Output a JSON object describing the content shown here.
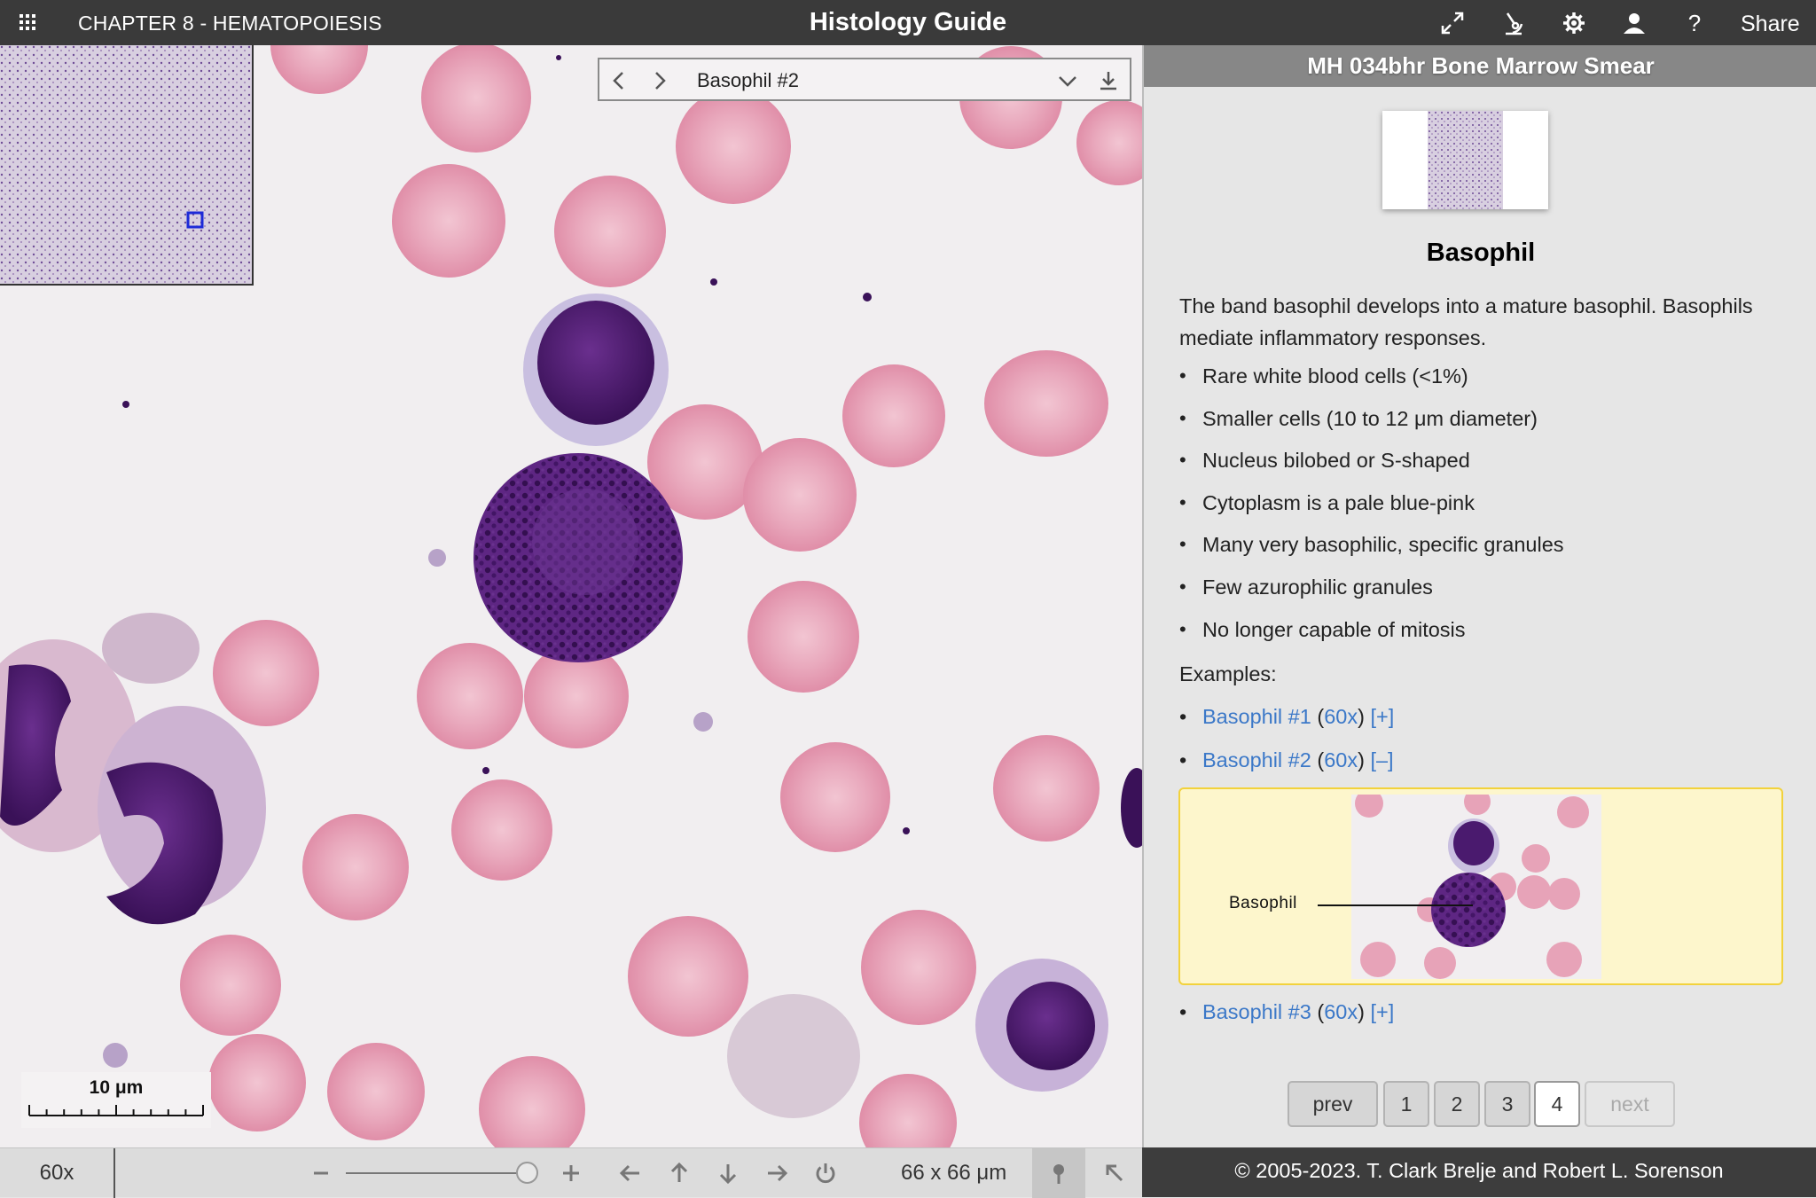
{
  "topbar": {
    "chapter": "CHAPTER 8 - HEMATOPOIESIS",
    "brand": "Histology Guide",
    "share": "Share",
    "icons": [
      "apps-grid-icon",
      "fullscreen-icon",
      "microscope-icon",
      "gear-icon",
      "user-icon",
      "help-icon"
    ]
  },
  "viewer": {
    "nav_label": "Basophil #2",
    "scale_label": "10 μm",
    "magnification": "60x",
    "dimensions": "66 x 66 μm",
    "zoom_level": 1.0
  },
  "panel": {
    "header": "MH 034bhr Bone Marrow Smear",
    "title": "Basophil",
    "description": "The band basophil develops into a mature basophil. Basophils mediate inflammatory responses.",
    "bullets": [
      "Rare white blood cells (<1%)",
      "Smaller cells (10 to 12 μm diameter)",
      "Nucleus bilobed or S-shaped",
      "Cytoplasm is a pale blue-pink",
      "Many very basophilic, specific granules",
      "Few azurophilic granules",
      "No longer capable of mitosis"
    ],
    "examples_label": "Examples:",
    "examples": [
      {
        "name": "Basophil #1",
        "mag": "60x",
        "toggle": "[+]"
      },
      {
        "name": "Basophil #2",
        "mag": "60x",
        "toggle": "[–]"
      },
      {
        "name": "Basophil #3",
        "mag": "60x",
        "toggle": "[+]"
      }
    ],
    "example_image_label": "Basophil",
    "pager": {
      "prev": "prev",
      "pages": [
        "1",
        "2",
        "3",
        "4"
      ],
      "current": "4",
      "next": "next"
    }
  },
  "footer": "© 2005-2023. T. Clark Brelje and Robert L. Sorenson",
  "colors": {
    "link": "#3b78c8",
    "rbc": "#e7a3b8",
    "nucleus": "#4a1a6e",
    "highlight_box": "#fdf6cc"
  }
}
